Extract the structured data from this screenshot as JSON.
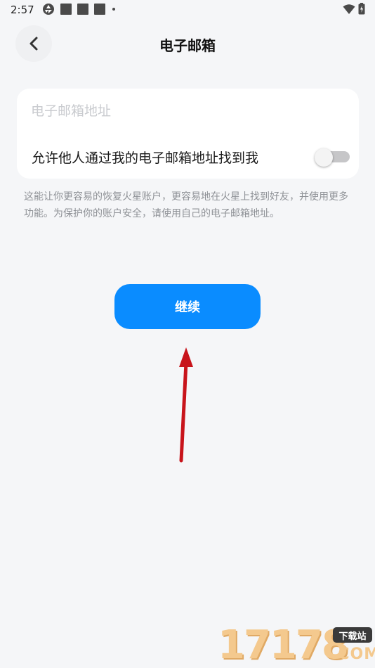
{
  "status_bar": {
    "time": "2:57"
  },
  "header": {
    "title": "电子邮箱"
  },
  "form": {
    "email_placeholder": "电子邮箱地址",
    "email_value": "",
    "toggle_label": "允许他人通过我的电子邮箱地址找到我",
    "toggle_on": false
  },
  "hint_text": "这能让你更容易的恢复火星账户，更容易地在火星上找到好友，并使用更多功能。为保护你的账户安全，请使用自己的电子邮箱地址。",
  "continue_label": "继续",
  "watermark": {
    "number": "17178",
    "badge": "下载站",
    "suffix": ".COM"
  },
  "colors": {
    "accent": "#0a8cff",
    "background": "#f5f6f8",
    "annotation_arrow": "#c8141b"
  }
}
